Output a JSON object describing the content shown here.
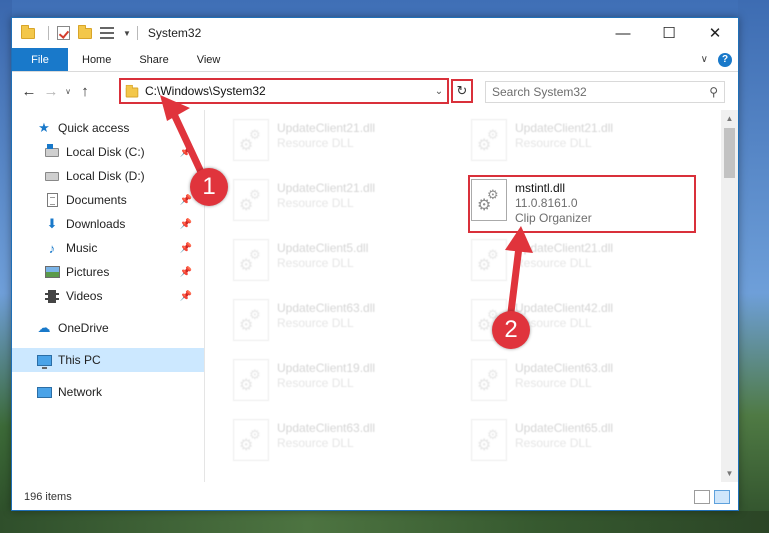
{
  "window": {
    "title": "System32",
    "controls": {
      "minimize": "—",
      "maximize": "☐",
      "close": "✕"
    }
  },
  "ribbon": {
    "tabs": [
      "File",
      "Home",
      "Share",
      "View"
    ],
    "help": "?"
  },
  "nav": {
    "address": "C:\\Windows\\System32",
    "search_placeholder": "Search System32"
  },
  "sidebar": {
    "items": [
      {
        "label": "Quick access"
      },
      {
        "label": "Local Disk (C:)"
      },
      {
        "label": "Local Disk (D:)"
      },
      {
        "label": "Documents"
      },
      {
        "label": "Downloads"
      },
      {
        "label": "Music"
      },
      {
        "label": "Pictures"
      },
      {
        "label": "Videos"
      },
      {
        "label": "OneDrive"
      },
      {
        "label": "This PC"
      },
      {
        "label": "Network"
      }
    ]
  },
  "files": [
    {
      "name": "UpdateClient21.dll",
      "type": "Resource DLL"
    },
    {
      "name": "UpdateClient21.dll",
      "type": "Resource DLL"
    },
    {
      "name": "UpdateClient21.dll",
      "type": "Resource DLL"
    },
    {
      "name": "mstintl.dll",
      "version": "11.0.8161.0",
      "type": "Clip Organizer"
    },
    {
      "name": "UpdateClient5.dll",
      "type": "Resource DLL"
    },
    {
      "name": "UpdateClient21.dll",
      "type": "Resource DLL"
    },
    {
      "name": "UpdateClient63.dll",
      "type": "Resource DLL"
    },
    {
      "name": "UpdateClient42.dll",
      "type": "Resource DLL"
    },
    {
      "name": "UpdateClient19.dll",
      "type": "Resource DLL"
    },
    {
      "name": "UpdateClient63.dll",
      "type": "Resource DLL"
    },
    {
      "name": "UpdateClient63.dll",
      "type": "Resource DLL"
    },
    {
      "name": "UpdateClient65.dll",
      "type": "Resource DLL"
    }
  ],
  "status": {
    "count": "196 items"
  },
  "annotations": {
    "step1": "1",
    "step2": "2",
    "color": "#e0343c"
  }
}
